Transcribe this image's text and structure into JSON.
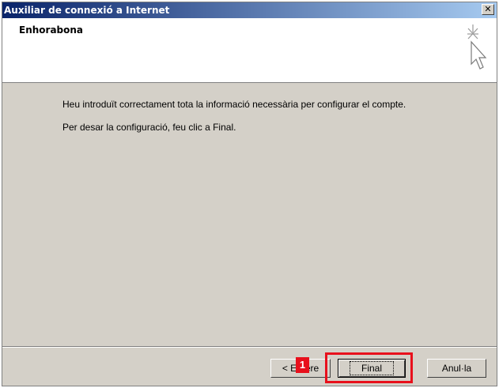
{
  "window": {
    "title": "Auxiliar de connexió a Internet",
    "close_glyph": "✕"
  },
  "header": {
    "title": "Enhorabona",
    "icon": "wizard-cursor-icon"
  },
  "body": {
    "line1": "Heu introduït correctament tota la informació necessària per configurar el compte.",
    "line2": "Per desar la configuració, feu clic a Final."
  },
  "buttons": {
    "back": "< Enrere",
    "finish": "Final",
    "cancel": "Anul·la"
  },
  "annotation": {
    "badge": "1",
    "color": "#e8101c"
  }
}
